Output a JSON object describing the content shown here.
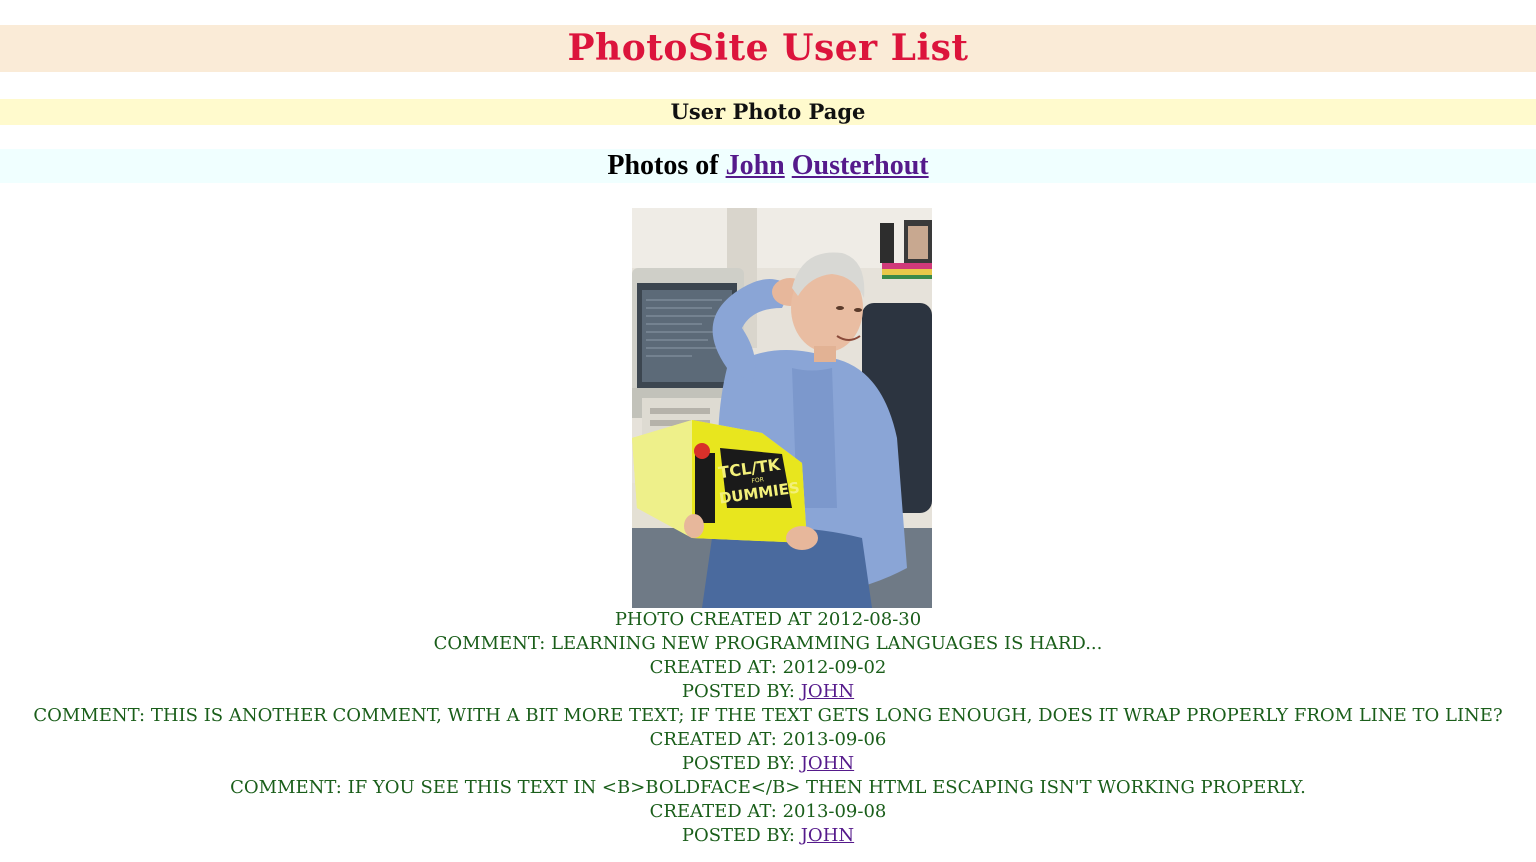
{
  "header": {
    "site_title": "PhotoSite User List",
    "page_subtitle": "User Photo Page"
  },
  "user_heading": {
    "prefix": "Photos of",
    "first_name": "John",
    "last_name": "Ousterhout"
  },
  "photo": {
    "alt": "John Ousterhout reading TCL/TK for Dummies",
    "created_label": "Photo created at",
    "created_at": "2012-08-30",
    "book_title_line1": "TCL/TK",
    "book_title_for": "FOR",
    "book_title_line2": "DUMMIES"
  },
  "labels": {
    "comment": "Comment:",
    "created_at": "Created at:",
    "posted_by": "Posted by:"
  },
  "comments": [
    {
      "text": "Learning new programming languages is hard...",
      "created_at": "2012-09-02",
      "posted_by": "John"
    },
    {
      "text": "This is another comment, with a bit more text; if the text gets long enough, does it wrap properly from line to line?",
      "created_at": "2013-09-06",
      "posted_by": "John"
    },
    {
      "text": "If you see this text in <b>boldface</b> then HTML escaping isn't working properly.",
      "created_at": "2013-09-08",
      "posted_by": "John"
    }
  ],
  "colors": {
    "title": "#dc143c",
    "title_bg": "#faebd7",
    "subtitle_bg": "#fffacd",
    "heading_bg": "#f0ffff",
    "details_text": "#1a5e1a",
    "link": "#551a8b"
  }
}
